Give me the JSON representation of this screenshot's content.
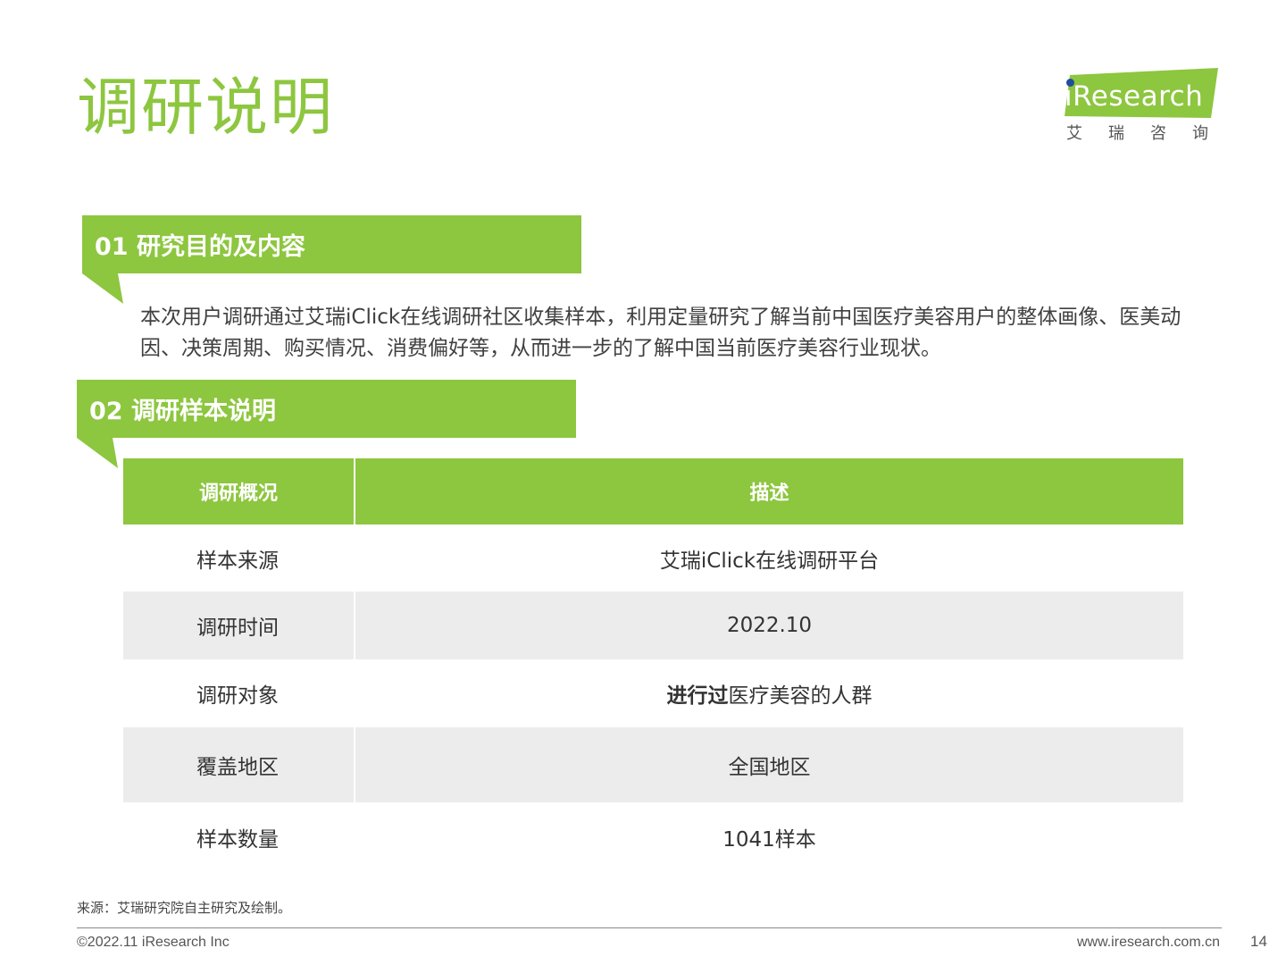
{
  "title": "调研说明",
  "logo": {
    "text": "Research",
    "cn": "艾瑞咨询",
    "colors": {
      "banner": "#8dc63f",
      "dot": "#1f4e9c"
    }
  },
  "sections": [
    {
      "label": "01 研究目的及内容"
    },
    {
      "label": "02 调研样本说明"
    }
  ],
  "intro_paragraph": "本次用户调研通过艾瑞iClick在线调研社区收集样本，利用定量研究了解当前中国医疗美容用户的整体画像、医美动因、决策周期、购买情况、消费偏好等，从而进一步的了解中国当前医疗美容行业现状。",
  "table": {
    "headers": [
      "调研概况",
      "描述"
    ],
    "rows": [
      {
        "label": "样本来源",
        "value": "艾瑞iClick在线调研平台"
      },
      {
        "label": "调研时间",
        "value": "2022.10"
      },
      {
        "label": "调研对象",
        "value_bold": "进行过",
        "value_rest": "医疗美容的人群"
      },
      {
        "label": "覆盖地区",
        "value": "全国地区"
      },
      {
        "label": "样本数量",
        "value": "1041样本"
      }
    ]
  },
  "source": "来源：艾瑞研究院自主研究及绘制。",
  "footer": {
    "copyright": "©2022.11 iResearch Inc",
    "website": "www.iresearch.com.cn",
    "page_number": "14"
  },
  "colors": {
    "accent": "#8dc63f",
    "row_shade": "#ececec"
  }
}
